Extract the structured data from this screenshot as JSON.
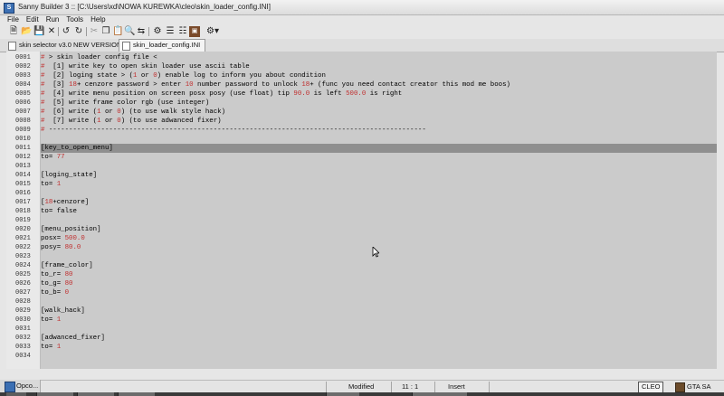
{
  "window": {
    "title": "Sanny Builder 3 :: [C:\\Users\\xd\\NOWA KUREWKA\\cleo\\skin_loader_config.INI]"
  },
  "menu": [
    "File",
    "Edit",
    "Run",
    "Tools",
    "Help"
  ],
  "toolbar": {
    "icons": [
      "new-file-icon",
      "open-file-icon",
      "save-icon",
      "close-icon",
      "undo-icon",
      "redo-icon",
      "cut-icon",
      "copy-icon",
      "paste-icon",
      "find-icon",
      "replace-icon",
      "compile-icon",
      "decompile-icon",
      "image-icon",
      "settings-icon"
    ]
  },
  "tabs": [
    {
      "label": "skin selector v3.0 NEW VERSION.txt",
      "active": false
    },
    {
      "label": "skin_loader_config.INI",
      "active": true
    }
  ],
  "editor": {
    "highlight_color": "#8f8f8f",
    "accent_number_color": "#c03030",
    "lines": [
      {
        "num": "0001",
        "segs": [
          {
            "t": "# ",
            "c": "hash"
          },
          {
            "t": "> skin loader config file <",
            "c": "comment"
          }
        ]
      },
      {
        "num": "0002",
        "segs": [
          {
            "t": "# ",
            "c": "hash"
          },
          {
            "t": " [1] write key to open skin loader use ascii table",
            "c": "comment"
          }
        ]
      },
      {
        "num": "0003",
        "segs": [
          {
            "t": "# ",
            "c": "hash"
          },
          {
            "t": " [2] loging state > (",
            "c": "comment"
          },
          {
            "t": "1",
            "c": "num"
          },
          {
            "t": " or ",
            "c": "comment"
          },
          {
            "t": "0",
            "c": "num"
          },
          {
            "t": ") enable log to inform you about condition",
            "c": "comment"
          }
        ]
      },
      {
        "num": "0004",
        "segs": [
          {
            "t": "# ",
            "c": "hash"
          },
          {
            "t": " [3] ",
            "c": "comment"
          },
          {
            "t": "18",
            "c": "num"
          },
          {
            "t": "+ cenzore password > enter ",
            "c": "comment"
          },
          {
            "t": "10",
            "c": "num"
          },
          {
            "t": " number password to unlock ",
            "c": "comment"
          },
          {
            "t": "18",
            "c": "num"
          },
          {
            "t": "+ (func you need contact creator this mod me boos)",
            "c": "comment"
          }
        ]
      },
      {
        "num": "0005",
        "segs": [
          {
            "t": "# ",
            "c": "hash"
          },
          {
            "t": " [4] write menu position on screen posx posy (use float) tip ",
            "c": "comment"
          },
          {
            "t": "90.0",
            "c": "num"
          },
          {
            "t": " is left ",
            "c": "comment"
          },
          {
            "t": "500.0",
            "c": "num"
          },
          {
            "t": " is right",
            "c": "comment"
          }
        ]
      },
      {
        "num": "0006",
        "segs": [
          {
            "t": "# ",
            "c": "hash"
          },
          {
            "t": " [5] write frame color rgb (use integer)",
            "c": "comment"
          }
        ]
      },
      {
        "num": "0007",
        "segs": [
          {
            "t": "# ",
            "c": "hash"
          },
          {
            "t": " [6] write (",
            "c": "comment"
          },
          {
            "t": "1",
            "c": "num"
          },
          {
            "t": " or ",
            "c": "comment"
          },
          {
            "t": "0",
            "c": "num"
          },
          {
            "t": ") (to use walk style hack)",
            "c": "comment"
          }
        ]
      },
      {
        "num": "0008",
        "segs": [
          {
            "t": "# ",
            "c": "hash"
          },
          {
            "t": " [7] write (",
            "c": "comment"
          },
          {
            "t": "1",
            "c": "num"
          },
          {
            "t": " or ",
            "c": "comment"
          },
          {
            "t": "0",
            "c": "num"
          },
          {
            "t": ") (to use adwanced fixer)",
            "c": "comment"
          }
        ]
      },
      {
        "num": "0009",
        "segs": [
          {
            "t": "# ",
            "c": "hash"
          },
          {
            "t": "----------------------------------------------------------------------------------------------",
            "c": "comment"
          }
        ]
      },
      {
        "num": "0010",
        "segs": []
      },
      {
        "num": "0011",
        "segs": [
          {
            "t": "[key_to_open_menu]",
            "c": "section"
          }
        ],
        "hl": true
      },
      {
        "num": "0012",
        "segs": [
          {
            "t": "to= ",
            "c": "plain"
          },
          {
            "t": "77",
            "c": "num"
          }
        ]
      },
      {
        "num": "0013",
        "segs": []
      },
      {
        "num": "0014",
        "segs": [
          {
            "t": "[loging_state]",
            "c": "section"
          }
        ]
      },
      {
        "num": "0015",
        "segs": [
          {
            "t": "to= ",
            "c": "plain"
          },
          {
            "t": "1",
            "c": "num"
          }
        ]
      },
      {
        "num": "0016",
        "segs": []
      },
      {
        "num": "0017",
        "segs": [
          {
            "t": "[",
            "c": "section"
          },
          {
            "t": "18",
            "c": "num"
          },
          {
            "t": "+cenzore]",
            "c": "section"
          }
        ]
      },
      {
        "num": "0018",
        "segs": [
          {
            "t": "to= false",
            "c": "plain"
          }
        ]
      },
      {
        "num": "0019",
        "segs": []
      },
      {
        "num": "0020",
        "segs": [
          {
            "t": "[menu_position]",
            "c": "section"
          }
        ]
      },
      {
        "num": "0021",
        "segs": [
          {
            "t": "posx= ",
            "c": "plain"
          },
          {
            "t": "500.0",
            "c": "num"
          }
        ]
      },
      {
        "num": "0022",
        "segs": [
          {
            "t": "posy= ",
            "c": "plain"
          },
          {
            "t": "80.0",
            "c": "num"
          }
        ]
      },
      {
        "num": "0023",
        "segs": []
      },
      {
        "num": "0024",
        "segs": [
          {
            "t": "[frame_color]",
            "c": "section"
          }
        ]
      },
      {
        "num": "0025",
        "segs": [
          {
            "t": "to_r= ",
            "c": "plain"
          },
          {
            "t": "80",
            "c": "num"
          }
        ]
      },
      {
        "num": "0026",
        "segs": [
          {
            "t": "to_g= ",
            "c": "plain"
          },
          {
            "t": "80",
            "c": "num"
          }
        ]
      },
      {
        "num": "0027",
        "segs": [
          {
            "t": "to_b= ",
            "c": "plain"
          },
          {
            "t": "0",
            "c": "num"
          }
        ]
      },
      {
        "num": "0028",
        "segs": []
      },
      {
        "num": "0029",
        "segs": [
          {
            "t": "[walk_hack]",
            "c": "section"
          }
        ]
      },
      {
        "num": "0030",
        "segs": [
          {
            "t": "to= ",
            "c": "plain"
          },
          {
            "t": "1",
            "c": "num"
          }
        ]
      },
      {
        "num": "0031",
        "segs": []
      },
      {
        "num": "0032",
        "segs": [
          {
            "t": "[adwanced_fixer]",
            "c": "section"
          }
        ]
      },
      {
        "num": "0033",
        "segs": [
          {
            "t": "to= ",
            "c": "plain"
          },
          {
            "t": "1",
            "c": "num"
          }
        ]
      },
      {
        "num": "0034",
        "segs": []
      }
    ]
  },
  "status": {
    "modified": "Modified",
    "position": "11 :  1",
    "mode": "Insert",
    "target": "CLEO",
    "game": "GTA SA"
  },
  "taskbar": {
    "opco_label": "Opco..."
  }
}
